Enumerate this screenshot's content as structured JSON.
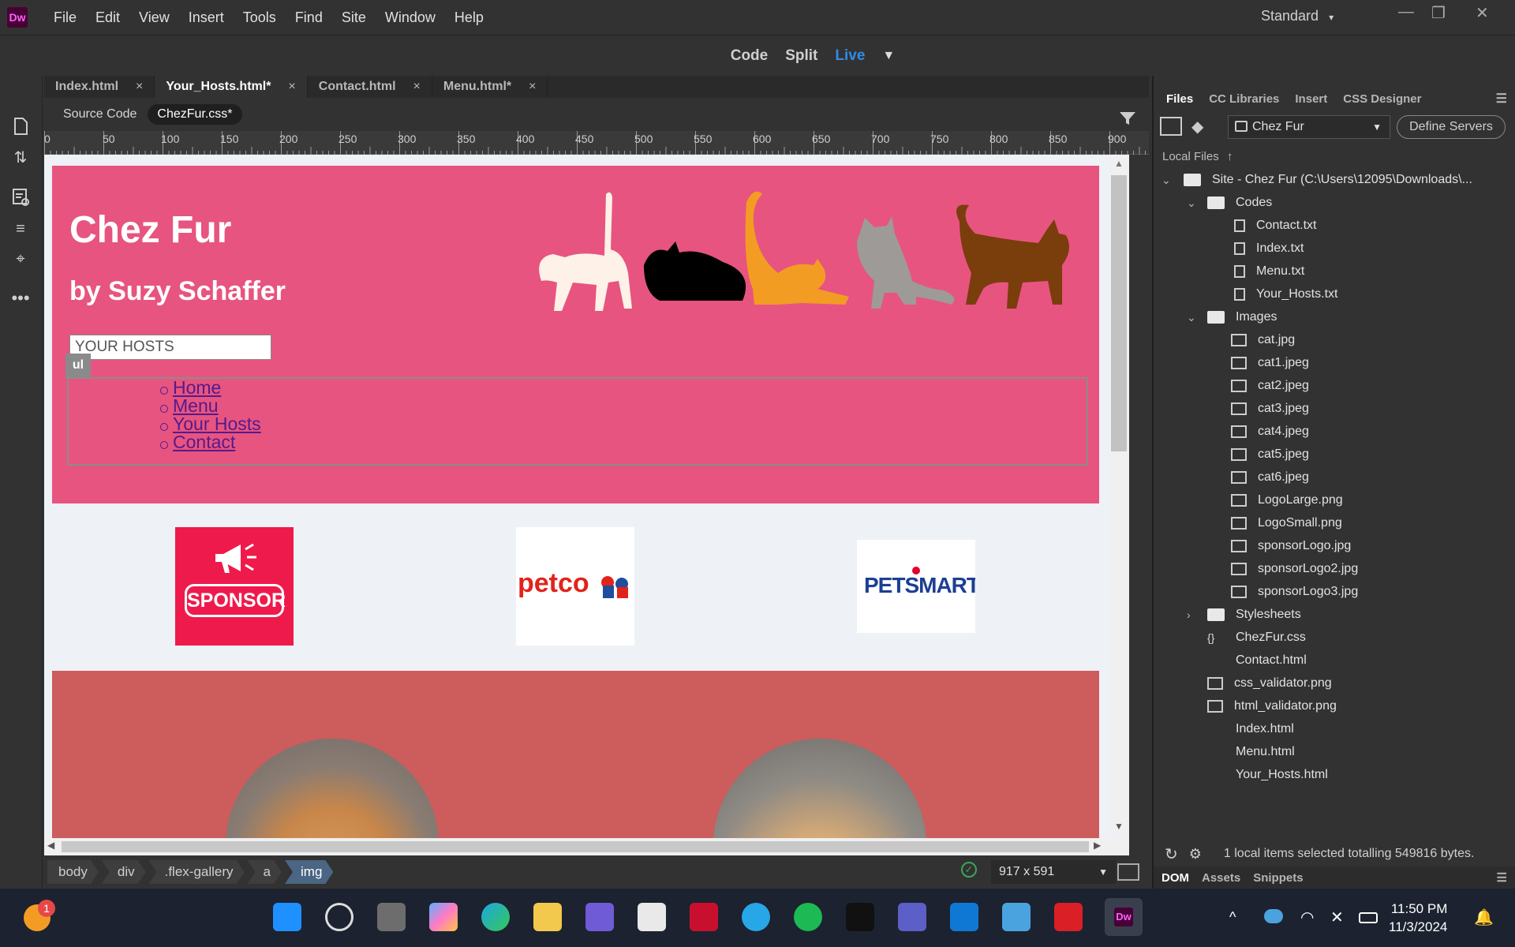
{
  "app": {
    "logo": "Dw",
    "workspace": "Standard"
  },
  "menus": [
    "File",
    "Edit",
    "View",
    "Insert",
    "Tools",
    "Find",
    "Site",
    "Window",
    "Help"
  ],
  "view_modes": {
    "code": "Code",
    "split": "Split",
    "live": "Live",
    "live_color": "#2d8ceb"
  },
  "doc_tabs": [
    {
      "label": "Index.html"
    },
    {
      "label": "Your_Hosts.html*"
    },
    {
      "label": "Contact.html"
    },
    {
      "label": "Menu.html*"
    }
  ],
  "tab_close": "×",
  "related_files": {
    "source": "Source Code",
    "css": "ChezFur.css*"
  },
  "ruler": {
    "ticks": [
      "0",
      "50",
      "100",
      "150",
      "200",
      "250",
      "300",
      "350",
      "400",
      "450",
      "500",
      "550",
      "600",
      "650",
      "700",
      "750",
      "800",
      "850",
      "900"
    ]
  },
  "page": {
    "title": "Chez Fur",
    "subtitle": "by Suzy Schaffer",
    "heading_input": "YOUR HOSTS",
    "element_badge": "ul",
    "nav": [
      "Home",
      "Menu",
      "Your Hosts",
      "Contact"
    ],
    "sponsors": {
      "sponsor": "SPONSOR",
      "petco": "petco",
      "petsmart": "PETSMART"
    },
    "header_color": "#e75480",
    "gallery_color": "#cd5c5c"
  },
  "statusbar": {
    "breadcrumbs": [
      "body",
      "div",
      ".flex-gallery",
      "a",
      "img"
    ],
    "viewport_size": "917 x 591"
  },
  "files_panel": {
    "tabs": [
      "Files",
      "CC Libraries",
      "Insert",
      "CSS Designer"
    ],
    "site_name": "Chez Fur",
    "define_servers": "Define Servers",
    "local_files": "Local Files",
    "site_root": "Site - Chez Fur   (C:\\Users\\12095\\Downloads\\...",
    "codes_folder": "Codes",
    "codes_files": [
      "Contact.txt",
      "Index.txt",
      "Menu.txt",
      "Your_Hosts.txt"
    ],
    "images_folder": "Images",
    "image_files": [
      "cat.jpg",
      "cat1.jpeg",
      "cat2.jpeg",
      "cat3.jpeg",
      "cat4.jpeg",
      "cat5.jpeg",
      "cat6.jpeg",
      "LogoLarge.png",
      "LogoSmall.png",
      "sponsorLogo.jpg",
      "sponsorLogo2.jpg",
      "sponsorLogo3.jpg"
    ],
    "stylesheets_folder": "Stylesheets",
    "root_files": [
      {
        "name": "ChezFur.css",
        "icon": "css-icon"
      },
      {
        "name": "Contact.html",
        "icon": "html-icon"
      },
      {
        "name": "css_validator.png",
        "icon": "image-icon"
      },
      {
        "name": "html_validator.png",
        "icon": "image-icon"
      },
      {
        "name": "Index.html",
        "icon": "html-icon"
      },
      {
        "name": "Menu.html",
        "icon": "html-icon"
      },
      {
        "name": "Your_Hosts.html",
        "icon": "html-icon"
      }
    ],
    "status": "1 local items selected totalling 549816 bytes.",
    "bottom_tabs": [
      "DOM",
      "Assets",
      "Snippets"
    ]
  },
  "taskbar": {
    "notification_count": "1",
    "time": "11:50 PM",
    "date": "11/3/2024"
  }
}
